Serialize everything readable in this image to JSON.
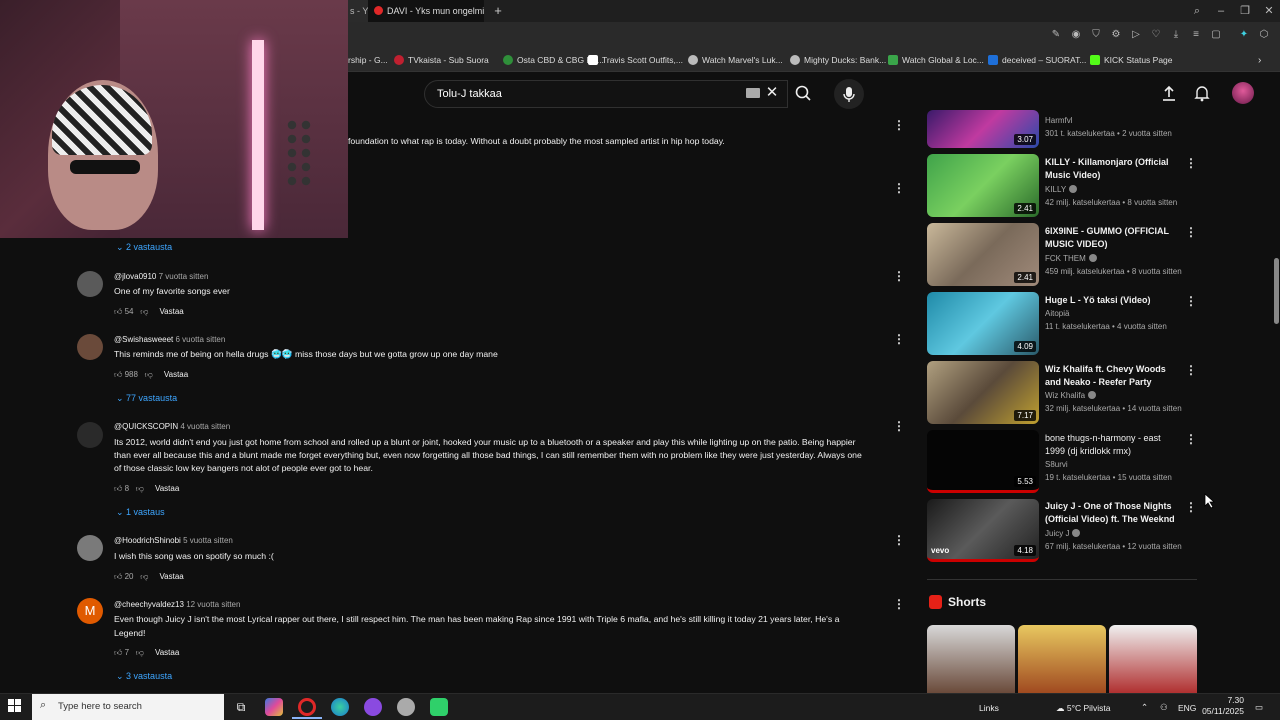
{
  "browser": {
    "active_tab_title": "DAVI - Yks mun ongelmis",
    "prev_tab_fragment": "s - Y"
  },
  "bookmarks": [
    {
      "label": "rship - G...",
      "color": "#4a4a4a"
    },
    {
      "label": "TVkaista - Sub Suora",
      "color": "#c02030"
    },
    {
      "label": "Osta CBD & CBG Ke...",
      "color": "#2f8f3a"
    },
    {
      "label": "Travis Scott Outfits,...",
      "color": "#ffffff"
    },
    {
      "label": "Watch Marvel's Luk...",
      "color": "#bbbbbb"
    },
    {
      "label": "Mighty Ducks: Bank...",
      "color": "#bbbbbb"
    },
    {
      "label": "Watch Global & Loc...",
      "color": "#3aa54a"
    },
    {
      "label": "deceived – SUORAT...",
      "color": "#1e6fd8"
    },
    {
      "label": "KICK Status Page",
      "color": "#53fc18"
    }
  ],
  "search": {
    "query": "Tolu-J  takkaa"
  },
  "partial_comment": {
    "text": "foundation to what rap is today. Without a doubt probably the most sampled artist in hip hop today."
  },
  "first_replies": "2 vastausta",
  "comments": [
    {
      "author": "@jlova0910",
      "time": "7 vuotta sitten",
      "text": [
        "One of my favorite songs ever"
      ],
      "likes": "54",
      "reply": "Vastaa",
      "replies": "",
      "avatar_color": "#5a5a5a"
    },
    {
      "author": "@Swishasweeet",
      "time": "6 vuotta sitten",
      "text": [
        "This reminds me of being on hella drugs 🥶🥶 miss those days but we gotta grow up one day mane"
      ],
      "likes": "988",
      "reply": "Vastaa",
      "replies": "77 vastausta",
      "avatar_color": "#6a4a3a"
    },
    {
      "author": "@QUICKSCOPIN",
      "time": "4 vuotta sitten",
      "text": [
        "Its 2012, world didn't end you just got home from school and rolled up a blunt or joint, hooked your music up to a bluetooth or a speaker and play this while lighting up on the patio. Being happier",
        "than ever all because this and a blunt made me forget everything but, even now forgetting all those bad things, I can still remember them with no problem like they were just yesterday. Always one",
        "of those classic low key bangers not alot of people ever got to hear."
      ],
      "likes": "8",
      "reply": "Vastaa",
      "replies": "1 vastaus",
      "avatar_color": "#2a2a2a"
    },
    {
      "author": "@HoodrichShinobi",
      "time": "5 vuotta sitten",
      "text": [
        "I wish this song was on spotify so much :("
      ],
      "likes": "20",
      "reply": "Vastaa",
      "replies": "",
      "avatar_color": "#7a7a7a"
    },
    {
      "author": "@cheechyvaldez13",
      "time": "12 vuotta sitten",
      "text": [
        "Even though Juicy J isn't the most Lyrical rapper out there, I still respect him. The man has been making Rap since 1991 with Triple 6 mafia, and he's still killing it today 21 years later, He's a",
        "Legend!"
      ],
      "likes": "7",
      "reply": "Vastaa",
      "replies": "3 vastausta",
      "avatar_color": "#e05a00",
      "avatar_letter": "M"
    }
  ],
  "videos": [
    {
      "title": [
        "Harmfvl"
      ],
      "channel": "",
      "stats": "301 t. katselukertaa • 2 vuotta sitten",
      "duration": "3.07",
      "thumb": "#5a2a8a",
      "verified": false,
      "title_is_channel": true
    },
    {
      "title": [
        "KILLY - Killamonjaro (Official",
        "Music Video)"
      ],
      "channel": "KILLY",
      "stats": "42 milj. katselukertaa • 8 vuotta sitten",
      "duration": "2.41",
      "thumb": "#3a9a4a",
      "verified": true
    },
    {
      "title": [
        "6IX9INE - GUMMO (OFFICIAL",
        "MUSIC VIDEO)"
      ],
      "channel": "FCK THEM",
      "stats": "459 milj. katselukertaa • 8 vuotta sitten",
      "duration": "2.41",
      "thumb": "#9a8a6a",
      "verified": true
    },
    {
      "title": [
        "Huge L - Yö taksi (Video)"
      ],
      "channel": "Aitopiä",
      "stats": "11 t. katselukertaa • 4 vuotta sitten",
      "duration": "4.09",
      "thumb": "#2a8aa0",
      "verified": false
    },
    {
      "title": [
        "Wiz Khalifa ft. Chevy Woods",
        "and Neako - Reefer Party"
      ],
      "channel": "Wiz Khalifa",
      "stats": "32 milj. katselukertaa • 14 vuotta sitten",
      "duration": "7.17",
      "thumb": "#8a7a5a",
      "verified": true
    },
    {
      "title": [
        "bone thugs-n-harmony - east",
        "1999 (dj kridlokk rmx)"
      ],
      "channel": "S8urvi",
      "stats": "19 t. katselukertaa • 15 vuotta sitten",
      "duration": "5.53",
      "thumb": "#0a0a0a",
      "verified": false
    },
    {
      "title": [
        "Juicy J - One of Those Nights",
        "(Official Video) ft. The Weeknd"
      ],
      "channel": "Juicy J",
      "stats": "67 milj. katselukertaa • 12 vuotta sitten",
      "duration": "4.18",
      "thumb": "#2a2a2a",
      "verified": true,
      "vevo": "vevo"
    }
  ],
  "shorts": {
    "heading": "Shorts"
  },
  "taskbar": {
    "search_placeholder": "Type here to search",
    "links": "Links",
    "weather": "5°C  Pilvista",
    "lang": "ENG",
    "time": "7.30",
    "date": "05/11/2025"
  }
}
